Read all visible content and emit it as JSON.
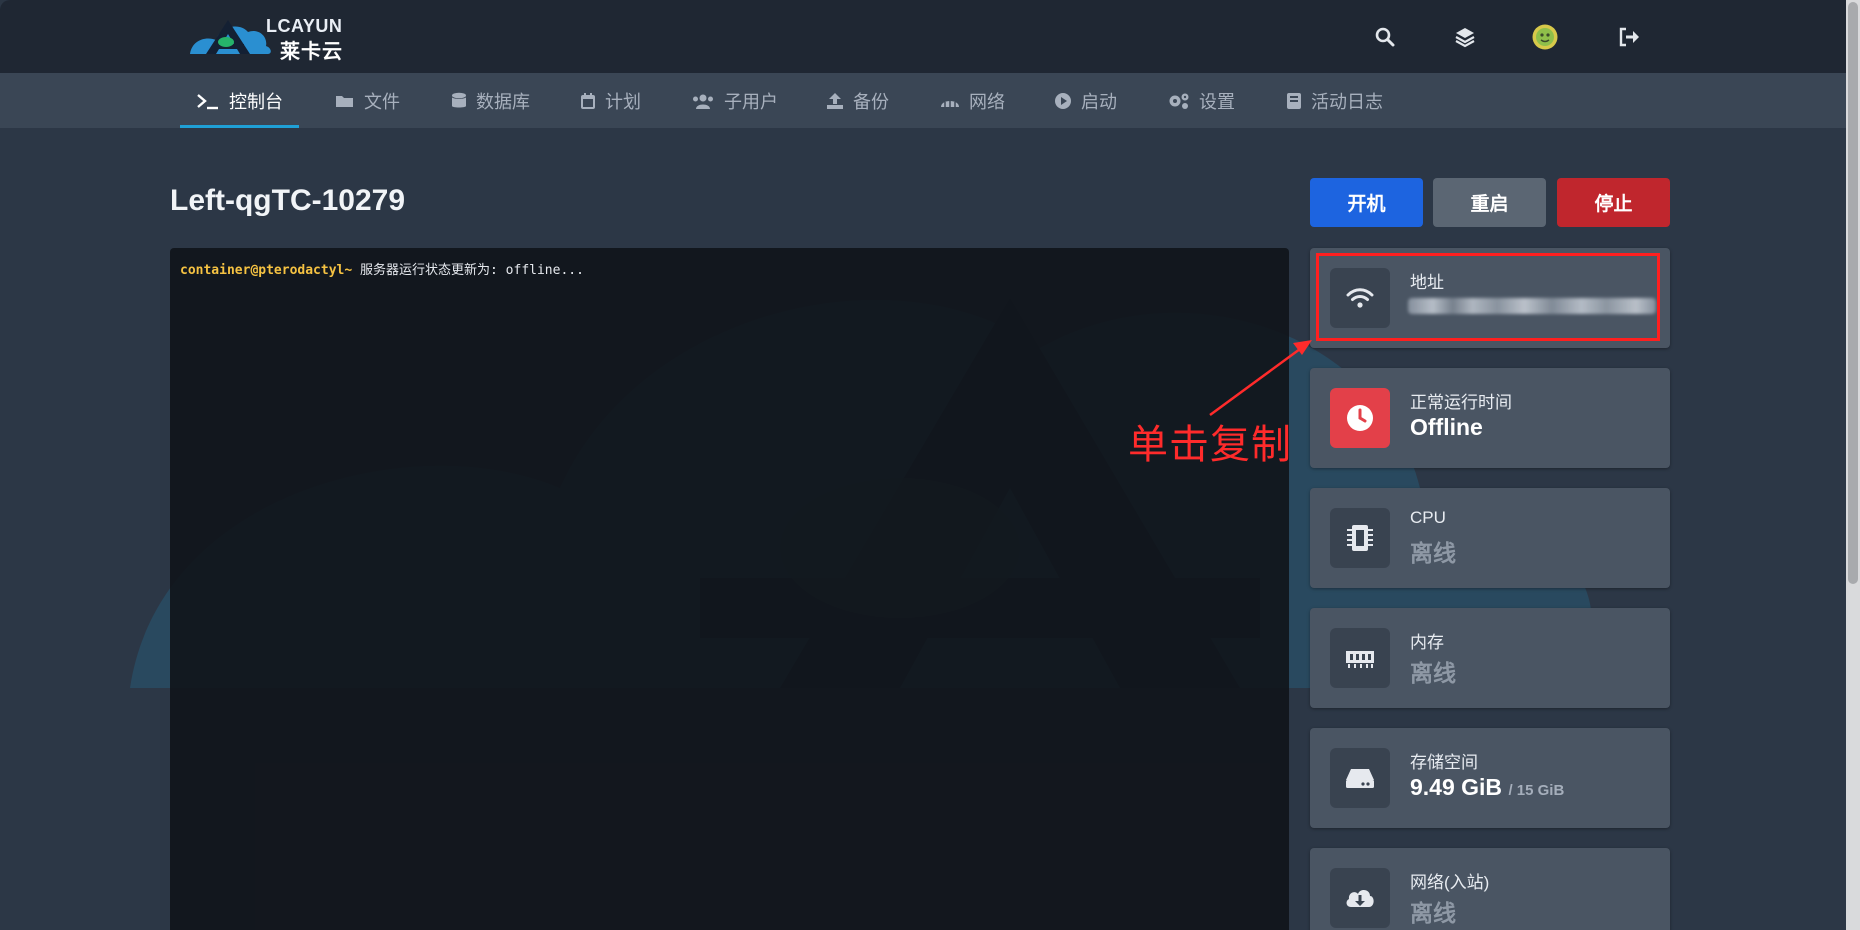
{
  "brand": {
    "logo_text": "LCAYUN",
    "logo_sub": "莱卡云"
  },
  "topbar_icons": [
    "search-icon",
    "layers-icon",
    "avatar",
    "logout-icon"
  ],
  "nav": [
    {
      "label": "控制台",
      "icon": "terminal-icon",
      "active": true
    },
    {
      "label": "文件",
      "icon": "folder-icon"
    },
    {
      "label": "数据库",
      "icon": "database-icon"
    },
    {
      "label": "计划",
      "icon": "calendar-icon"
    },
    {
      "label": "子用户",
      "icon": "users-icon"
    },
    {
      "label": "备份",
      "icon": "upload-icon"
    },
    {
      "label": "网络",
      "icon": "network-icon"
    },
    {
      "label": "启动",
      "icon": "play-icon"
    },
    {
      "label": "设置",
      "icon": "cogs-icon"
    },
    {
      "label": "活动日志",
      "icon": "book-icon"
    }
  ],
  "server": {
    "name": "Left-qgTC-10279"
  },
  "buttons": {
    "start": "开机",
    "restart": "重启",
    "stop": "停止"
  },
  "console": {
    "prompt": "container@pteroda​ctyl~",
    "message": " 服务器运行状态更新为: offline..."
  },
  "stats": {
    "address": {
      "label": "地址",
      "icon": "wifi-icon"
    },
    "uptime": {
      "label": "正常运行时间",
      "value": "Offline",
      "icon": "clock-icon"
    },
    "cpu": {
      "label": "CPU",
      "value": "离线",
      "icon": "cpu-icon"
    },
    "memory": {
      "label": "内存",
      "value": "离线",
      "icon": "memory-icon"
    },
    "storage": {
      "label": "存储空间",
      "value": "9.49 GiB",
      "limit": "/ 15 GiB",
      "icon": "hdd-icon"
    },
    "network_in": {
      "label": "网络(入站)",
      "value": "离线",
      "icon": "cloud-download-icon"
    }
  },
  "annotation": {
    "text": "单击复制",
    "color": "#ff2b2b"
  },
  "colors": {
    "start": "#1d64e0",
    "restart": "#5b6673",
    "stop": "#c0262d",
    "accent": "#1fa0d6"
  }
}
